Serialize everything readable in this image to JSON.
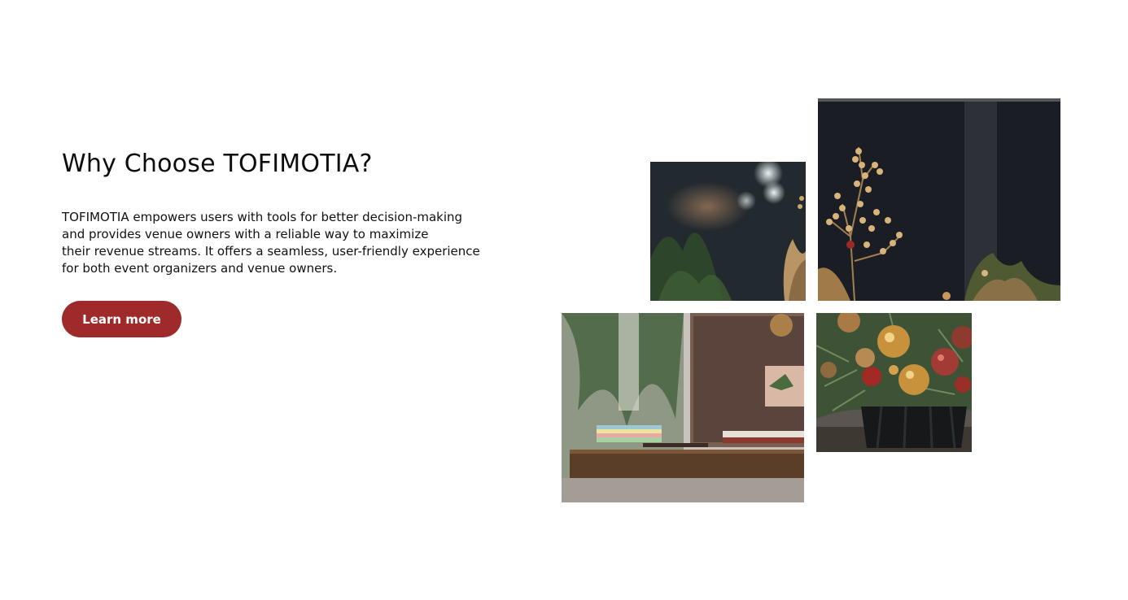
{
  "section": {
    "title": "Why Choose TOFIMOTIA?",
    "description_lines": [
      "TOFIMOTIA empowers users with tools for better decision-making",
      "and provides venue owners with a reliable way to maximize",
      "their revenue streams. It offers a seamless, user-friendly experience",
      "for both event organizers and venue owners."
    ],
    "cta_label": "Learn more"
  },
  "colors": {
    "accent": "#9e2a2b",
    "text": "#111111",
    "background": "#ffffff"
  },
  "gallery": [
    {
      "name": "photo-bokeh-plant"
    },
    {
      "name": "photo-golden-berry-branch"
    },
    {
      "name": "photo-desk-laptop"
    },
    {
      "name": "photo-ornament-arrangement"
    }
  ]
}
